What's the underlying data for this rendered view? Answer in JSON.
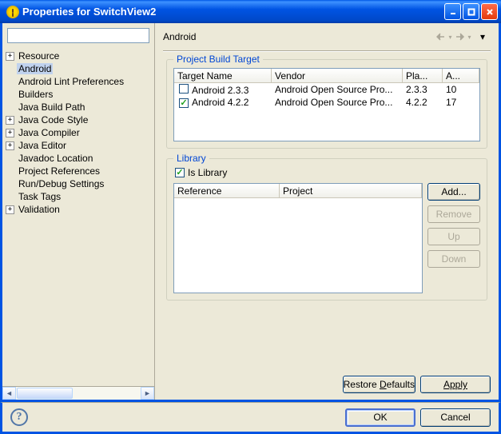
{
  "window": {
    "title": "Properties for SwitchView2"
  },
  "page": {
    "title": "Android"
  },
  "tree": {
    "items": [
      {
        "label": "Resource",
        "expander": "+",
        "selected": false
      },
      {
        "label": "Android",
        "expander": "",
        "selected": true
      },
      {
        "label": "Android Lint Preferences",
        "expander": "",
        "selected": false
      },
      {
        "label": "Builders",
        "expander": "",
        "selected": false
      },
      {
        "label": "Java Build Path",
        "expander": "",
        "selected": false
      },
      {
        "label": "Java Code Style",
        "expander": "+",
        "selected": false
      },
      {
        "label": "Java Compiler",
        "expander": "+",
        "selected": false
      },
      {
        "label": "Java Editor",
        "expander": "+",
        "selected": false
      },
      {
        "label": "Javadoc Location",
        "expander": "",
        "selected": false
      },
      {
        "label": "Project References",
        "expander": "",
        "selected": false
      },
      {
        "label": "Run/Debug Settings",
        "expander": "",
        "selected": false
      },
      {
        "label": "Task Tags",
        "expander": "",
        "selected": false
      },
      {
        "label": "Validation",
        "expander": "+",
        "selected": false
      }
    ]
  },
  "build_target": {
    "legend": "Project Build Target",
    "columns": {
      "name": "Target Name",
      "vendor": "Vendor",
      "platform": "Pla...",
      "api": "A..."
    },
    "rows": [
      {
        "checked": false,
        "name": "Android 2.3.3",
        "vendor": "Android Open Source Pro...",
        "platform": "2.3.3",
        "api": "10"
      },
      {
        "checked": true,
        "name": "Android 4.2.2",
        "vendor": "Android Open Source Pro...",
        "platform": "4.2.2",
        "api": "17"
      }
    ]
  },
  "library": {
    "legend": "Library",
    "is_library_label": "Is Library",
    "is_library_checked": true,
    "columns": {
      "reference": "Reference",
      "project": "Project"
    },
    "buttons": {
      "add": "Add...",
      "remove": "Remove",
      "up": "Up",
      "down": "Down"
    }
  },
  "footer": {
    "restore": "Restore Defaults",
    "apply": "Apply"
  },
  "bottom": {
    "ok": "OK",
    "cancel": "Cancel"
  }
}
